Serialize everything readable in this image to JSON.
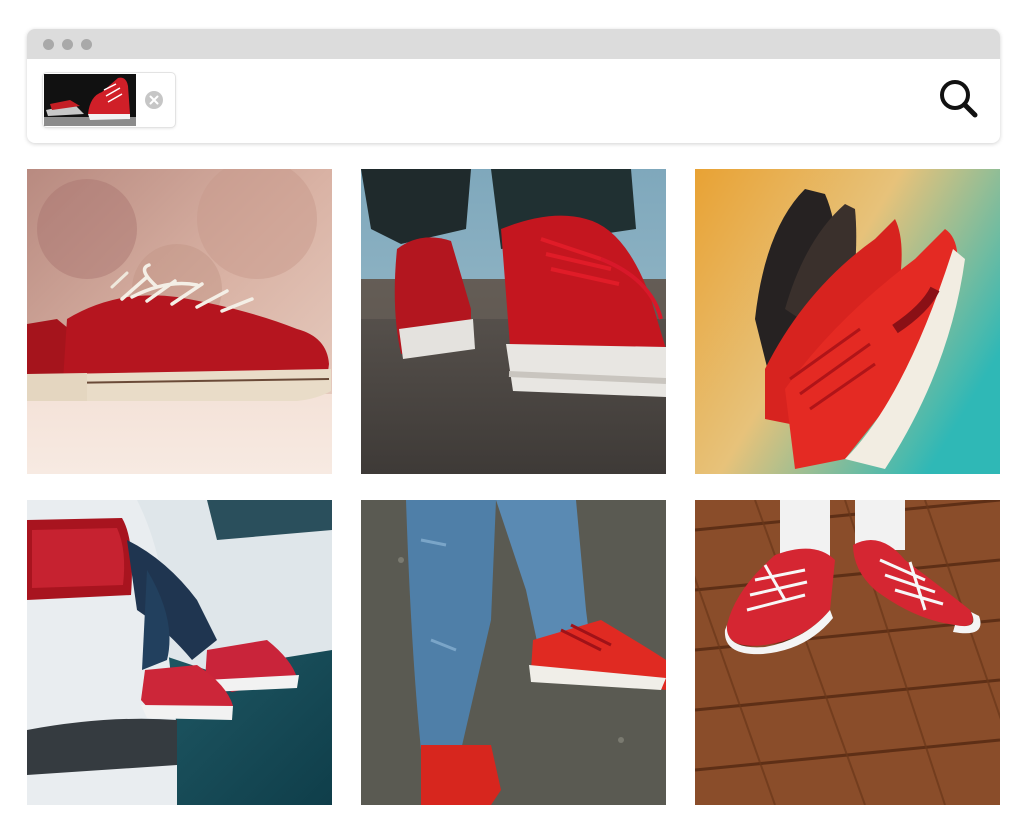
{
  "search_bar": {
    "query_image": {
      "icon": "red-sneakers-thumbnail"
    },
    "remove_icon": "close-circle-icon",
    "search_icon": "search-icon"
  },
  "results": [
    {
      "icon": "red-canvas-sneakers-photo"
    },
    {
      "icon": "red-sneakers-on-asphalt-photo"
    },
    {
      "icon": "red-running-shoes-against-wall-photo"
    },
    {
      "icon": "red-sneakers-car-trunk-photo"
    },
    {
      "icon": "red-running-shoes-jeans-photo"
    },
    {
      "icon": "red-sneakers-wood-floor-photo"
    }
  ],
  "colors": {
    "accent_red": "#d0202c",
    "titlebar": "#dcdcdc",
    "window_dot": "#a9a9a9"
  }
}
